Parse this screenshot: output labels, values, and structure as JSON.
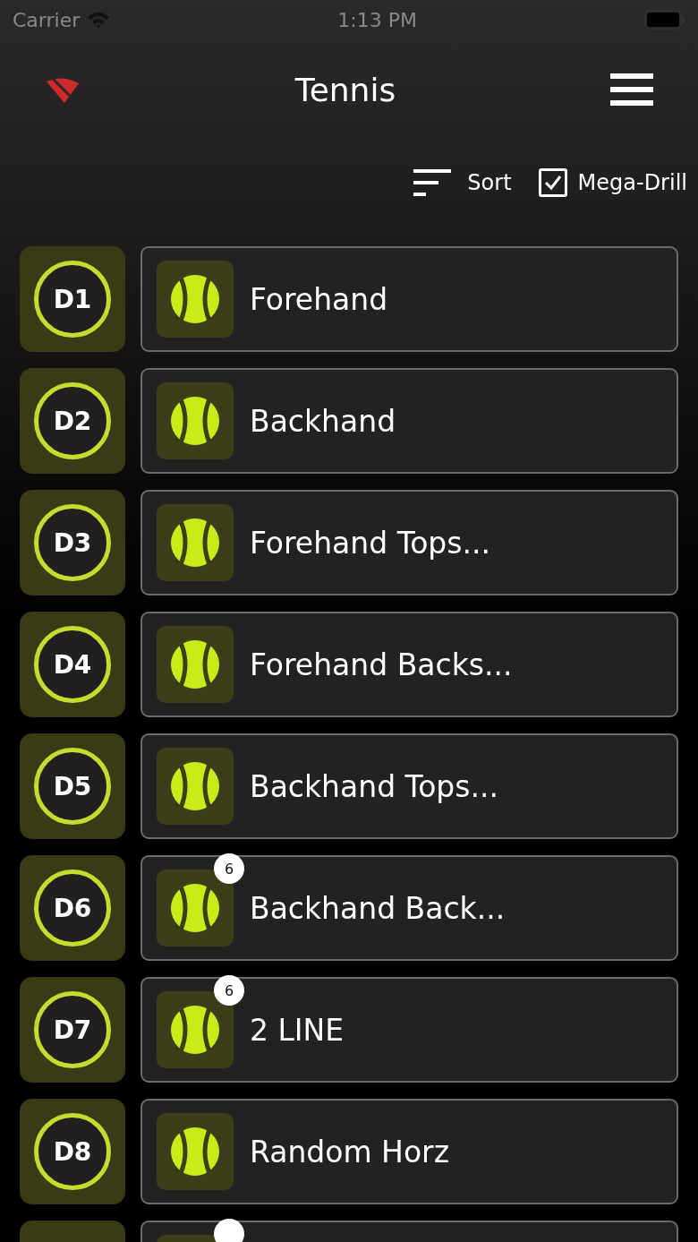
{
  "status_bar": {
    "carrier": "Carrier",
    "time": "1:13 PM"
  },
  "header": {
    "title": "Tennis",
    "offline": true
  },
  "toolbar": {
    "sort_label": "Sort",
    "mega_drill": {
      "label": "Mega-Drill",
      "checked": true
    }
  },
  "drills": [
    {
      "kind": "full",
      "code": "D1",
      "name": "Forehand"
    },
    {
      "kind": "full",
      "code": "D2",
      "name": "Backhand"
    },
    {
      "kind": "full",
      "code": "D3",
      "name": "Forehand Tops..."
    },
    {
      "kind": "full",
      "code": "D4",
      "name": "Forehand Backs..."
    },
    {
      "kind": "full",
      "code": "D5",
      "name": "Backhand Tops..."
    },
    {
      "kind": "full",
      "code": "D6",
      "name": "Backhand Back...",
      "badge": "6"
    },
    {
      "kind": "full",
      "code": "D7",
      "name": "2 LINE",
      "badge": "6"
    },
    {
      "kind": "full",
      "code": "D8",
      "name": "Random Horz"
    },
    {
      "kind": "partial",
      "has_badge": true
    }
  ]
}
